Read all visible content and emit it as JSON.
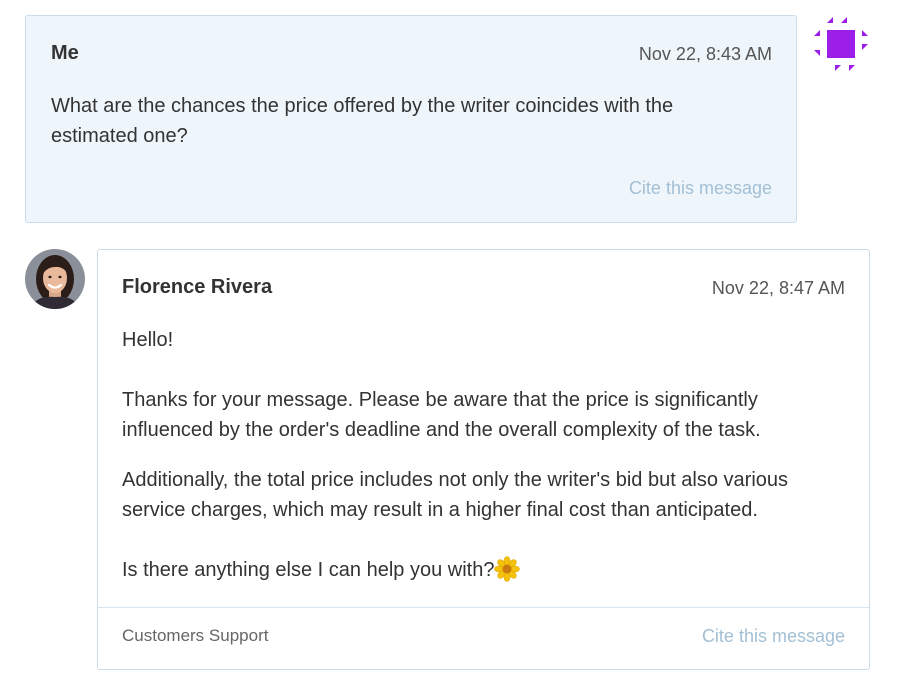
{
  "messages": [
    {
      "author": "Me",
      "timestamp": "Nov 22, 8:43 AM",
      "text": "What are the chances the price offered by the writer coincides with the estimated one?",
      "cite_label": "Cite this message",
      "avatar_icon": "purple-geometric-avatar-icon"
    },
    {
      "author": "Florence Rivera",
      "timestamp": "Nov 22, 8:47 AM",
      "paragraphs": [
        "Hello!",
        "Thanks for your message. Please be aware that the price is significantly influenced by the order's deadline and the overall complexity of the task.",
        "Additionally, the total price includes not only the writer's bid but also various service charges, which may result in a higher final cost than anticipated.",
        "Is there anything else I can help you with?"
      ],
      "emoji_icon": "sunflower-icon",
      "signature": "Customers Support",
      "cite_label": "Cite this message",
      "avatar_icon": "support-agent-photo"
    }
  ],
  "colors": {
    "me_card_bg": "#eef6fc",
    "card_border": "#c9dcea",
    "cite_link": "#a3bfd4",
    "avatar_accent": "#9b1fe8"
  }
}
